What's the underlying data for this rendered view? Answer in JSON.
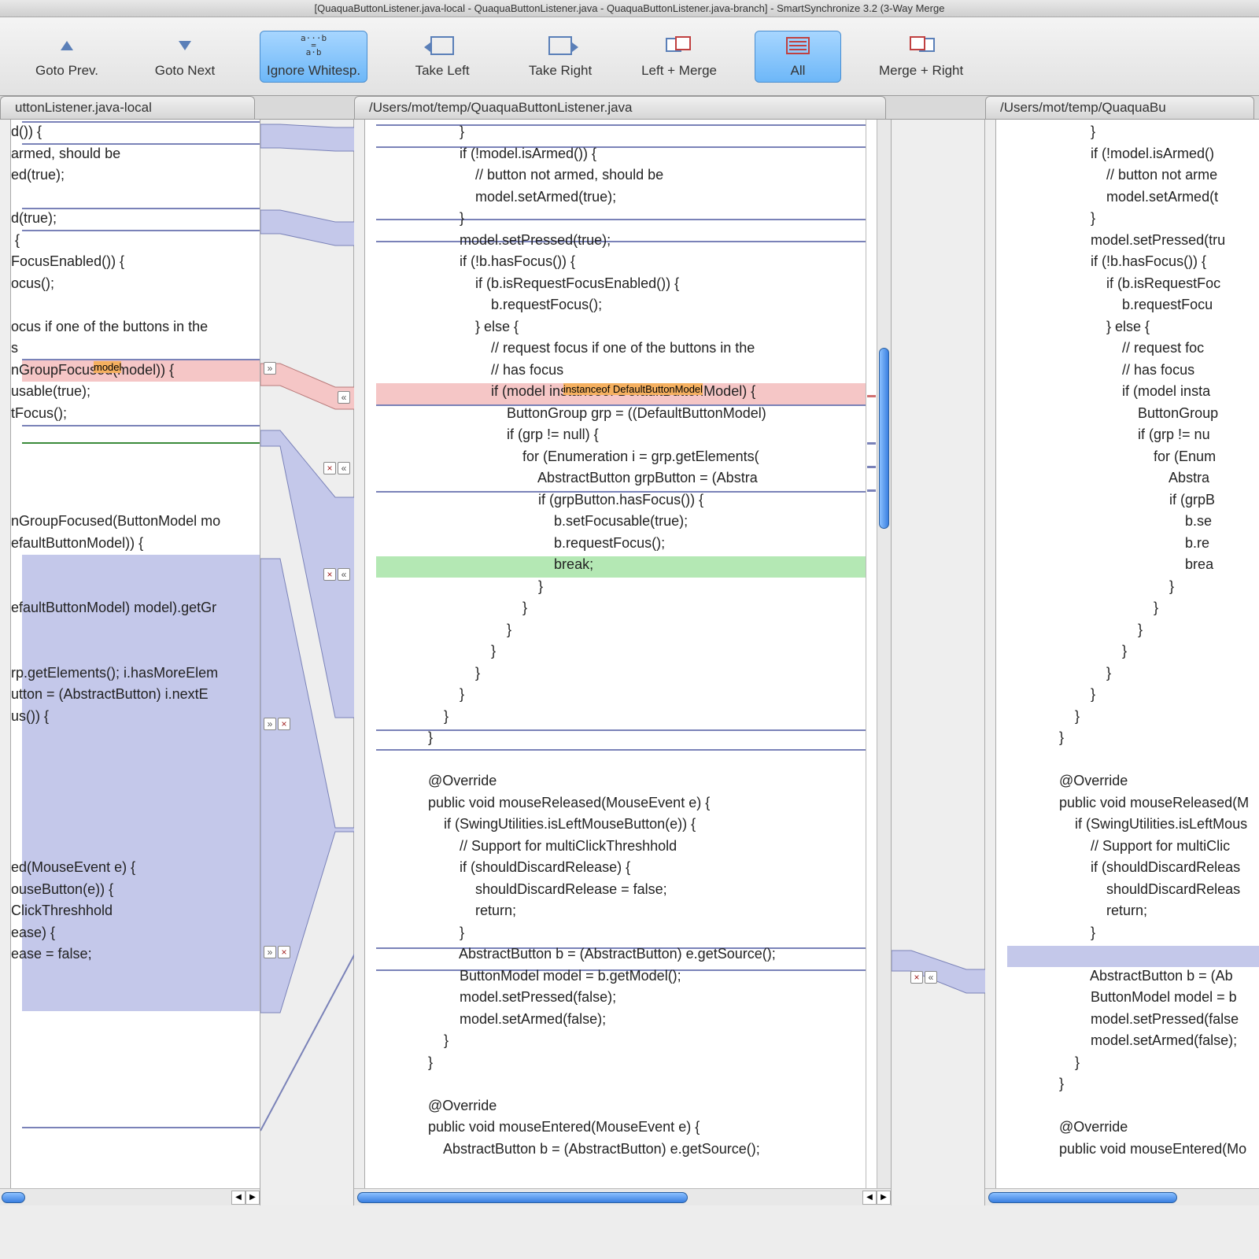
{
  "title": "[QuaquaButtonListener.java-local - QuaquaButtonListener.java - QuaquaButtonListener.java-branch] - SmartSynchronize 3.2 (3-Way Merge",
  "toolbar": {
    "goto_prev": "Goto Prev.",
    "goto_next": "Goto Next",
    "ignore_ws": "Ignore Whitesp.",
    "take_left": "Take Left",
    "take_right": "Take Right",
    "left_merge": "Left + Merge",
    "all": "All",
    "merge_right": "Merge + Right"
  },
  "paths": {
    "left": "uttonListener.java-local",
    "mid": "/Users/mot/temp/QuaquaButtonListener.java",
    "right": "/Users/mot/temp/QuaquaBu"
  },
  "code": {
    "left": "d()) {\narmed, should be\ned(true);\n\nd(true);\n {\nFocusEnabled()) {\nocus();\n\nocus if one of the buttons in the\ns\nnGroupFocused(model)) {\nusable(true);\ntFocus();\n\n\n\n\nnGroupFocused(ButtonModel mo\nefaultButtonModel)) {\n\n\nefaultButtonModel) model).getGr\n\n\nrp.getElements(); i.hasMoreElem\nutton = (AbstractButton) i.nextE\nus()) {\n\n\n\n\n\n\ned(MouseEvent e) {\nouseButton(e)) {\nClickThreshhold\nease) {\nease = false;\n",
    "mid": "                        }\n                        if (!model.isArmed()) {\n                            // button not armed, should be\n                            model.setArmed(true);\n                        }\n                        model.setPressed(true);\n                        if (!b.hasFocus()) {\n                            if (b.isRequestFocusEnabled()) {\n                                b.requestFocus();\n                            } else {\n                                // request focus if one of the buttons in the\n                                // has focus\n                                if (model instanceof DefaultButtonModel) {\n                                    ButtonGroup grp = ((DefaultButtonModel)\n                                    if (grp != null) {\n                                        for (Enumeration i = grp.getElements(\n                                            AbstractButton grpButton = (Abstra\n                                            if (grpButton.hasFocus()) {\n                                                b.setFocusable(true);\n                                                b.requestFocus();\n                                                break;\n                                            }\n                                        }\n                                    }\n                                }\n                            }\n                        }\n                    }\n                }\n\n                @Override\n                public void mouseReleased(MouseEvent e) {\n                    if (SwingUtilities.isLeftMouseButton(e)) {\n                        // Support for multiClickThreshhold\n                        if (shouldDiscardRelease) {\n                            shouldDiscardRelease = false;\n                            return;\n                        }\n                        AbstractButton b = (AbstractButton) e.getSource();\n                        ButtonModel model = b.getModel();\n                        model.setPressed(false);\n                        model.setArmed(false);\n                    }\n                }\n\n                @Override\n                public void mouseEntered(MouseEvent e) {\n                    AbstractButton b = (AbstractButton) e.getSource();",
    "right": "                        }\n                        if (!model.isArmed()\n                            // button not arme\n                            model.setArmed(t\n                        }\n                        model.setPressed(tru\n                        if (!b.hasFocus()) {\n                            if (b.isRequestFoc\n                                b.requestFocu\n                            } else {\n                                // request foc\n                                // has focus\n                                if (model insta\n                                    ButtonGroup\n                                    if (grp != nu\n                                        for (Enum\n                                            Abstra\n                                            if (grpB\n                                                b.se\n                                                b.re\n                                                brea\n                                            }\n                                        }\n                                    }\n                                }\n                            }\n                        }\n                    }\n                }\n\n                @Override\n                public void mouseReleased(M\n                    if (SwingUtilities.isLeftMous\n                        // Support for multiClic\n                        if (shouldDiscardReleas\n                            shouldDiscardReleas\n                            return;\n                        }\n\n                        AbstractButton b = (Ab\n                        ButtonModel model = b\n                        model.setPressed(false\n                        model.setArmed(false);\n                    }\n                }\n\n                @Override\n                public void mouseEntered(Mo"
  },
  "highlight": {
    "mid_red_inner": "instanceof DefaultButtonModel",
    "left_red_inner": "model"
  },
  "connector_btn": {
    "push_left": "»",
    "push_right": "«",
    "reject": "×"
  },
  "scroll_arrows": {
    "left": "◀",
    "right": "▶"
  }
}
